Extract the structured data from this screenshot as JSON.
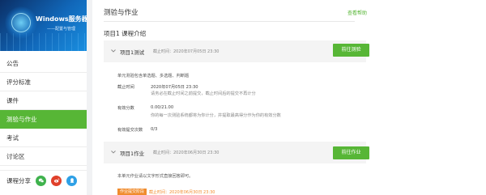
{
  "course_banner": {
    "title": "Windows服务器",
    "subtitle": "——配置与管理"
  },
  "nav": {
    "items": [
      "公告",
      "评分标准",
      "课件",
      "测验与作业",
      "考试",
      "讨论区"
    ],
    "active_index": 3
  },
  "share": {
    "label": "课程分享"
  },
  "page": {
    "title": "测验与作业",
    "help": "查看帮助"
  },
  "section": {
    "title": "项目1 课程介绍"
  },
  "quiz": {
    "name": "项目1测试",
    "deadline": "截止时间：2020年07月05日 23:30",
    "button": "前往测验",
    "description": "单元测验包含单选题、多选题、判断题",
    "deadline_label": "截止时间",
    "deadline_value": "2020年07月05日 23:30",
    "deadline_note": "请务必在截止时间之前提交，截止时间后的提交不再计分",
    "score_label": "有效分数",
    "score_value": "0.00/21.00",
    "score_note": "你的每一次测验系统都将为你计分，并提取最高得分作为你的有效分数",
    "attempts_label": "有效提交次数",
    "attempts_value": "0/3"
  },
  "homework": {
    "name": "项目1作业",
    "deadline": "截止时间：2020年06月30日 23:30",
    "button": "前往作业",
    "description": "本单元作业请以文字形式直接回答即可。",
    "status_badge": "作业提交阶段",
    "status_deadline": "截止时间：2020年06月30日 23:30"
  },
  "colors": {
    "accent": "#57b636",
    "badge": "#f08c2e"
  }
}
